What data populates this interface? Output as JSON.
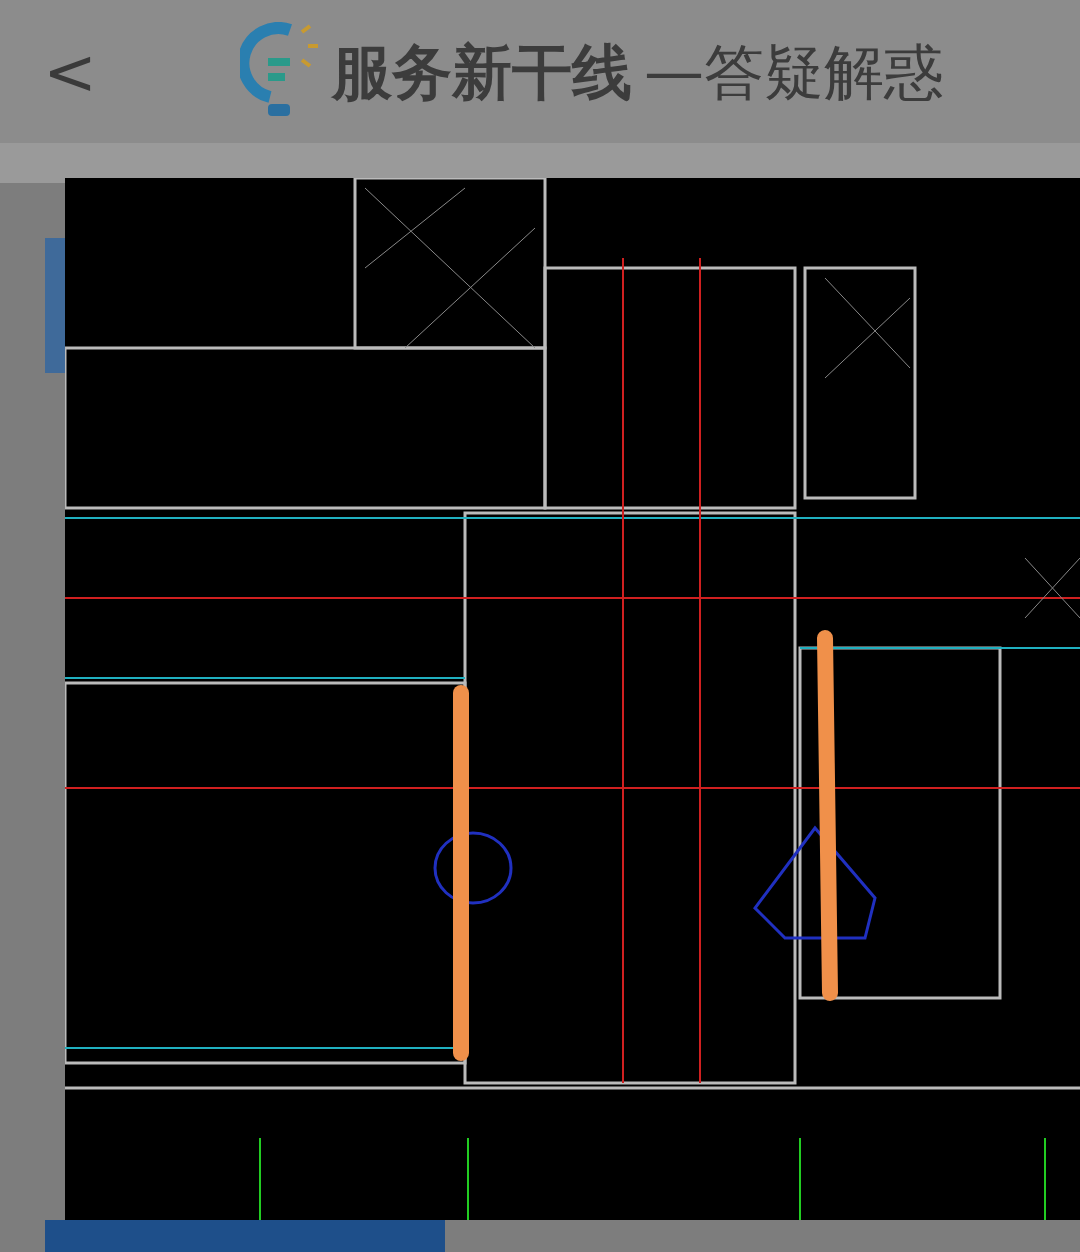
{
  "header": {
    "back": "<",
    "title": "服务新干线",
    "subtitle": "—答疑解惑"
  }
}
